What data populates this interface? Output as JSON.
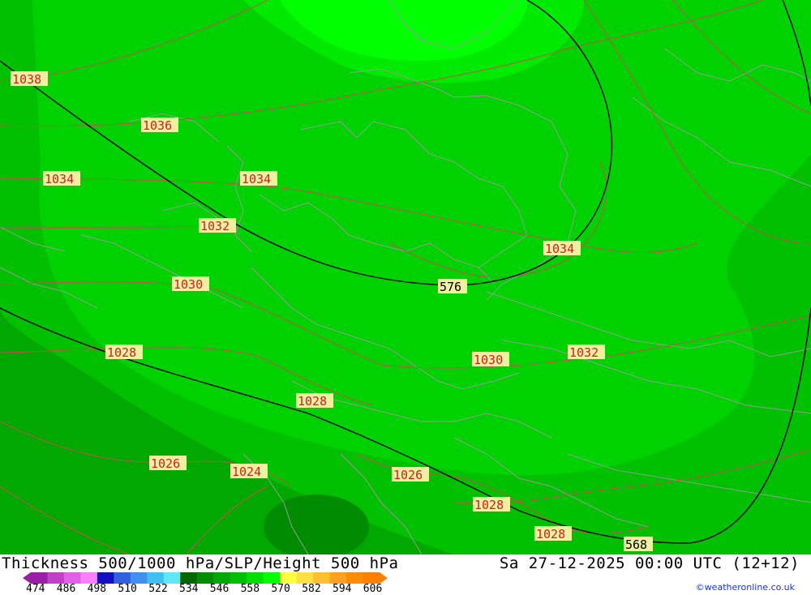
{
  "title_left": "Thickness 500/1000 hPa/SLP/Height 500 hPa",
  "title_right": "Sa 27-12-2025 00:00 UTC (12+12)",
  "credit": "©weatheronline.co.uk",
  "colors": {
    "zone_dark": "#00a800",
    "zone_mid": "#00c000",
    "zone_main": "#00d200",
    "zone_bright": "#00ea00",
    "zone_top": "#00ff00",
    "zone_deep": "#008c00",
    "isobar": "#c85050",
    "border": "#9a9a9a",
    "height_contour": "#000000",
    "label_bg": "#f0f0a0"
  },
  "isobar_labels": [
    "1038",
    "1036",
    "1034",
    "1034",
    "1032",
    "1030",
    "1028",
    "1028",
    "1026",
    "1024",
    "1026",
    "1028",
    "1028",
    "1030",
    "1032",
    "1034"
  ],
  "height_labels": [
    "576",
    "568"
  ],
  "scale": {
    "ticks": [
      "474",
      "486",
      "498",
      "510",
      "522",
      "534",
      "546",
      "558",
      "570",
      "582",
      "594",
      "606"
    ],
    "colors": [
      "#9a1fa5",
      "#c040c8",
      "#e060e8",
      "#ff80ff",
      "#1010c0",
      "#3060e0",
      "#4090f0",
      "#40c0f0",
      "#60e8f8",
      "#006600",
      "#008c00",
      "#00a800",
      "#00c000",
      "#00e000",
      "#00ff00",
      "#ffff40",
      "#ffe040",
      "#ffc030",
      "#ffa020",
      "#ff8c00",
      "#ff8000"
    ]
  }
}
